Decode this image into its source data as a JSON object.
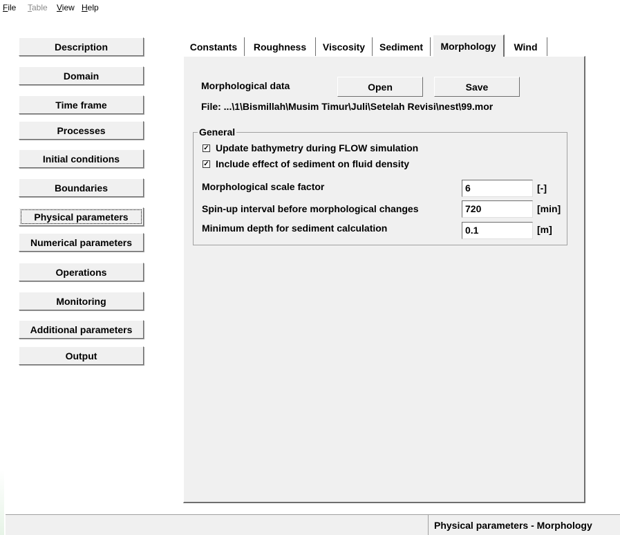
{
  "menu": [
    {
      "label": "File",
      "underline": "F",
      "rest": "ile",
      "enabled": true
    },
    {
      "label": "Table",
      "underline": "T",
      "rest": "able",
      "enabled": false
    },
    {
      "label": "View",
      "underline": "V",
      "rest": "iew",
      "enabled": true
    },
    {
      "label": "Help",
      "underline": "H",
      "rest": "elp",
      "enabled": true
    }
  ],
  "sidebar": {
    "items": [
      {
        "label": "Description"
      },
      {
        "label": "Domain"
      },
      {
        "label": "Time frame"
      },
      {
        "label": "Processes"
      },
      {
        "label": "Initial conditions"
      },
      {
        "label": "Boundaries"
      },
      {
        "label": "Physical parameters",
        "selected": true
      },
      {
        "label": "Numerical parameters"
      },
      {
        "label": "Operations"
      },
      {
        "label": "Monitoring"
      },
      {
        "label": "Additional parameters"
      },
      {
        "label": "Output"
      }
    ]
  },
  "tabs": [
    {
      "label": "Constants"
    },
    {
      "label": "Roughness"
    },
    {
      "label": "Viscosity"
    },
    {
      "label": "Sediment"
    },
    {
      "label": "Morphology",
      "active": true
    },
    {
      "label": "Wind"
    }
  ],
  "morphology": {
    "data_label": "Morphological data",
    "open_label": "Open",
    "save_label": "Save",
    "file_line": "File:  ...\\1\\Bismillah\\Musim Timur\\Juli\\Setelah Revisi\\nest\\99.mor",
    "general": {
      "title": "General",
      "update_bathymetry": {
        "label": "Update bathymetry during FLOW simulation",
        "checked": true
      },
      "sediment_density": {
        "label": "Include effect of sediment on fluid density",
        "checked": true
      },
      "scale_factor": {
        "label": "Morphological scale factor",
        "value": "6",
        "unit": "[-]"
      },
      "spinup": {
        "label": "Spin-up interval before morphological changes",
        "value": "720",
        "unit": "[min]"
      },
      "min_depth": {
        "label": "Minimum depth for sediment calculation",
        "value": "0.1",
        "unit": "[m]"
      }
    }
  },
  "status": {
    "right_text": "Physical parameters - Morphology"
  }
}
